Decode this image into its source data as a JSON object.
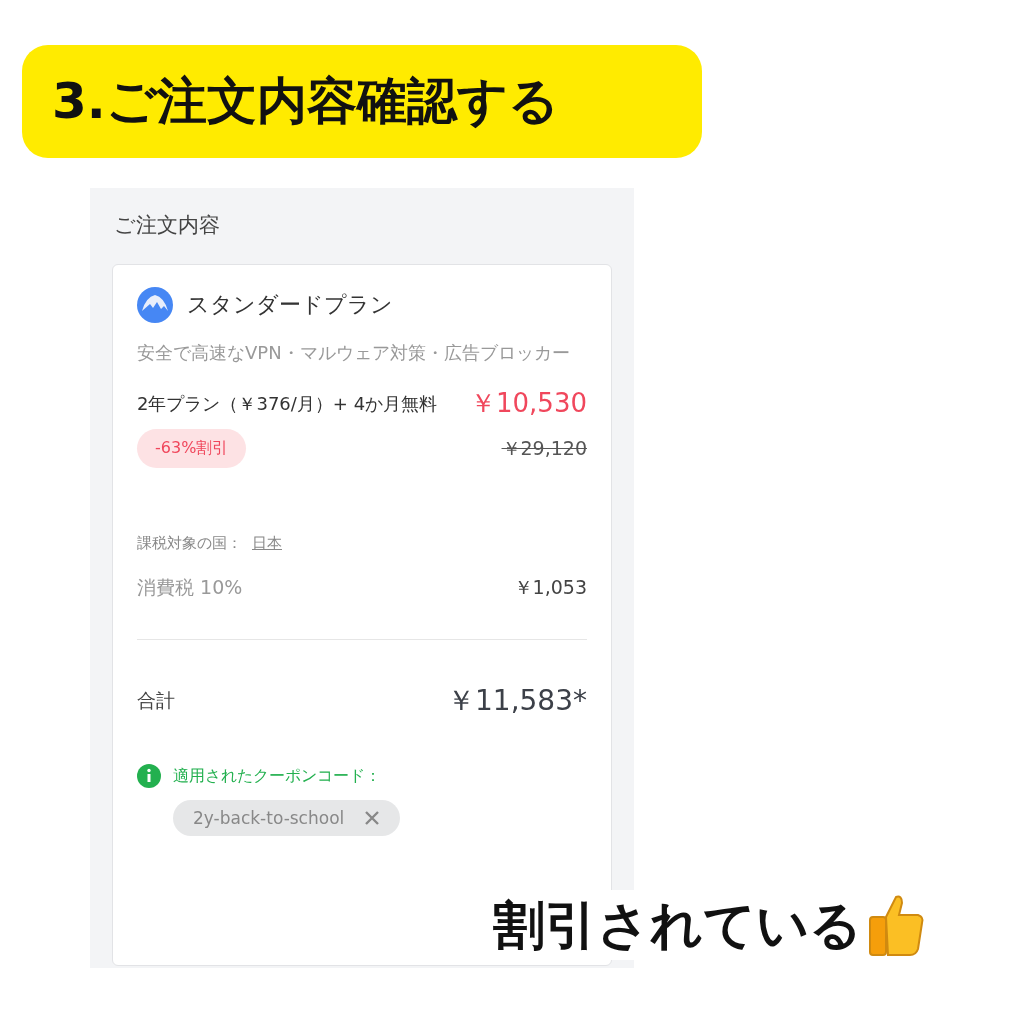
{
  "heading": "3.ご注文内容確認する",
  "panel": {
    "title": "ご注文内容",
    "plan": {
      "name": "スタンダードプラン",
      "description": "安全で高速なVPN・マルウェア対策・広告ブロッカー",
      "term": "2年プラン（￥376/月）+ 4か月無料",
      "price": "￥10,530",
      "discount": "-63%割引",
      "original_price": "￥29,120"
    },
    "tax_country": {
      "label": "課税対象の国：",
      "value": "日本"
    },
    "tax": {
      "label": "消費税 10%",
      "value": "￥1,053"
    },
    "total": {
      "label": "合計",
      "value": "￥11,583*"
    },
    "coupon": {
      "label": "適用されたクーポンコード：",
      "code": "2y-back-to-school"
    }
  },
  "annotation": "割引されている"
}
